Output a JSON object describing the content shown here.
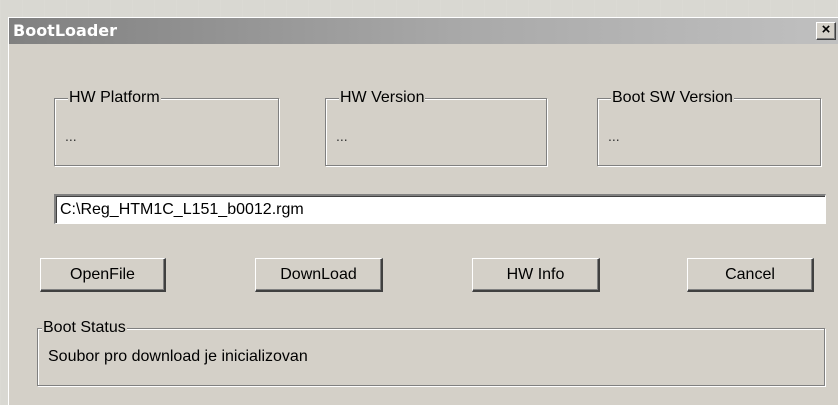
{
  "window": {
    "title": "BootLoader",
    "close_glyph": "×"
  },
  "groups": {
    "hw_platform": {
      "label": "HW Platform",
      "value": "..."
    },
    "hw_version": {
      "label": "HW Version",
      "value": "..."
    },
    "boot_sw_version": {
      "label": "Boot SW Version",
      "value": "..."
    }
  },
  "file_path": {
    "value": "C:\\Reg_HTM1C_L151_b0012.rgm"
  },
  "buttons": {
    "open_file": "OpenFile",
    "download": "DownLoad",
    "hw_info": "HW Info",
    "cancel": "Cancel"
  },
  "boot_status": {
    "label": "Boot Status",
    "message": "Soubor pro download je inicializovan"
  },
  "icons": {
    "close": "close-icon"
  }
}
